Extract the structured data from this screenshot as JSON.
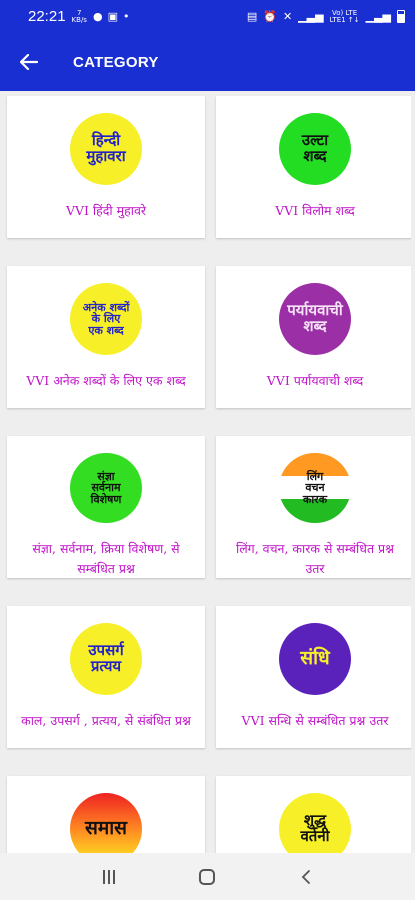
{
  "status_bar": {
    "time": "22:21",
    "net_speed_top": "7",
    "net_speed_bottom": "KB/s",
    "icons_left": [
      "chat-icon",
      "image-icon"
    ],
    "dot": "•",
    "icons_right": [
      "nfc-icon",
      "alarm-icon",
      "mute-icon",
      "wifi-icon",
      "signal-icon",
      "battery-icon"
    ],
    "volte_top": "Vo) LTE",
    "volte_bottom": "LTE1 ↑↓"
  },
  "app_bar": {
    "title": "CATEGORY",
    "back_icon": "arrow-left-icon"
  },
  "categories": [
    {
      "label": "VVI हिंदी मुहावरे",
      "logo_text": [
        "हिन्दी",
        "मुहावरा"
      ],
      "logo_bg": "#f7f028",
      "logo_fg": "#2222cc"
    },
    {
      "label": "VVI विलोम शब्द",
      "logo_text": [
        "उल्टा",
        "शब्द"
      ],
      "logo_bg": "#22dd22",
      "logo_fg": "#111111"
    },
    {
      "label": "VVI अनेक शब्दों के लिए एक शब्द",
      "logo_text": [
        "अनेक शब्दों",
        "के लिए",
        "एक शब्द"
      ],
      "logo_bg": "#f7f028",
      "logo_fg": "#2222cc"
    },
    {
      "label": "VVI पर्यायवाची शब्द",
      "logo_text": [
        "पर्यायवाची",
        "शब्द"
      ],
      "logo_bg": "#9b2fa5",
      "logo_fg": "#f4e2f5"
    },
    {
      "label": "संज्ञा, सर्वनाम, क्रिया विशेषण, से सम्बंधित प्रश्न",
      "logo_text": [
        "संज्ञा",
        "सर्वनाम",
        "विशेषण"
      ],
      "logo_bg": "#33dd22",
      "logo_fg": "#111111"
    },
    {
      "label": "लिंग, वचन, कारक से सम्बंधित प्रश्न उतर",
      "logo_text": [
        "लिंग",
        "वचन",
        "कारक"
      ],
      "logo_bg": "tricolor",
      "logo_fg": "#111111"
    },
    {
      "label": "काल, उपसर्ग , प्रत्यय, से संबंधित प्रश्न",
      "logo_text": [
        "उपसर्ग",
        "प्रत्यय"
      ],
      "logo_bg": "#f7f028",
      "logo_fg": "#2222cc"
    },
    {
      "label": "VVI सन्धि से सम्बंधित प्रश्न उतर",
      "logo_text": [
        "संधि"
      ],
      "logo_bg": "#5b22bb",
      "logo_fg": "#f7f028"
    },
    {
      "label": "",
      "logo_text": [
        "समास"
      ],
      "logo_bg": "gradient-red-yellow",
      "logo_fg": "#111111"
    },
    {
      "label": "",
      "logo_text": [
        "शुद्ध",
        "वर्तनी"
      ],
      "logo_bg": "#f7f028",
      "logo_fg": "#111111"
    }
  ],
  "nav_bar": {
    "icons": [
      "recent-apps-icon",
      "home-icon",
      "back-icon"
    ]
  },
  "colors": {
    "primary": "#1a2fd1",
    "label": "#c015c8",
    "background": "#eeeeee"
  }
}
